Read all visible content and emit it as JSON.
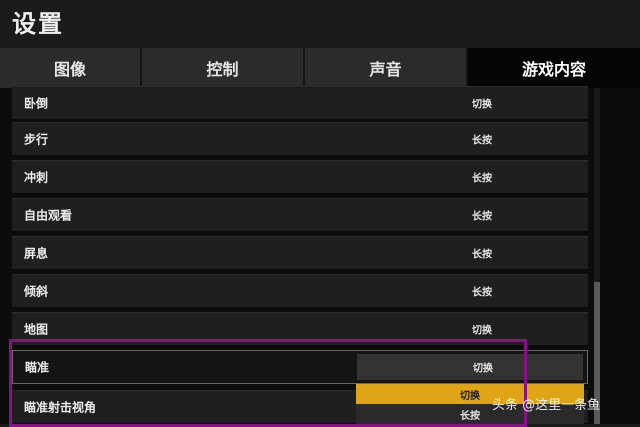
{
  "header": {
    "title": "设置"
  },
  "tabs": [
    {
      "label": "图像"
    },
    {
      "label": "控制"
    },
    {
      "label": "声音"
    },
    {
      "label": "游戏内容"
    }
  ],
  "rows": [
    {
      "label": "卧倒",
      "value": "切换"
    },
    {
      "label": "步行",
      "value": "长按"
    },
    {
      "label": "冲刺",
      "value": "长按"
    },
    {
      "label": "自由观看",
      "value": "长按"
    },
    {
      "label": "屏息",
      "value": "长按"
    },
    {
      "label": "倾斜",
      "value": "长按"
    },
    {
      "label": "地图",
      "value": "切换"
    },
    {
      "label": "瞄准",
      "value": "切换"
    },
    {
      "label": "瞄准射击视角",
      "value": ""
    }
  ],
  "dropdown": {
    "options": [
      "切换",
      "长按"
    ],
    "highlighted": "切换"
  },
  "watermark": "头条 @这里一条鱼",
  "colors": {
    "accent": "#e0a417",
    "highlight_frame": "#8a0f8a"
  }
}
